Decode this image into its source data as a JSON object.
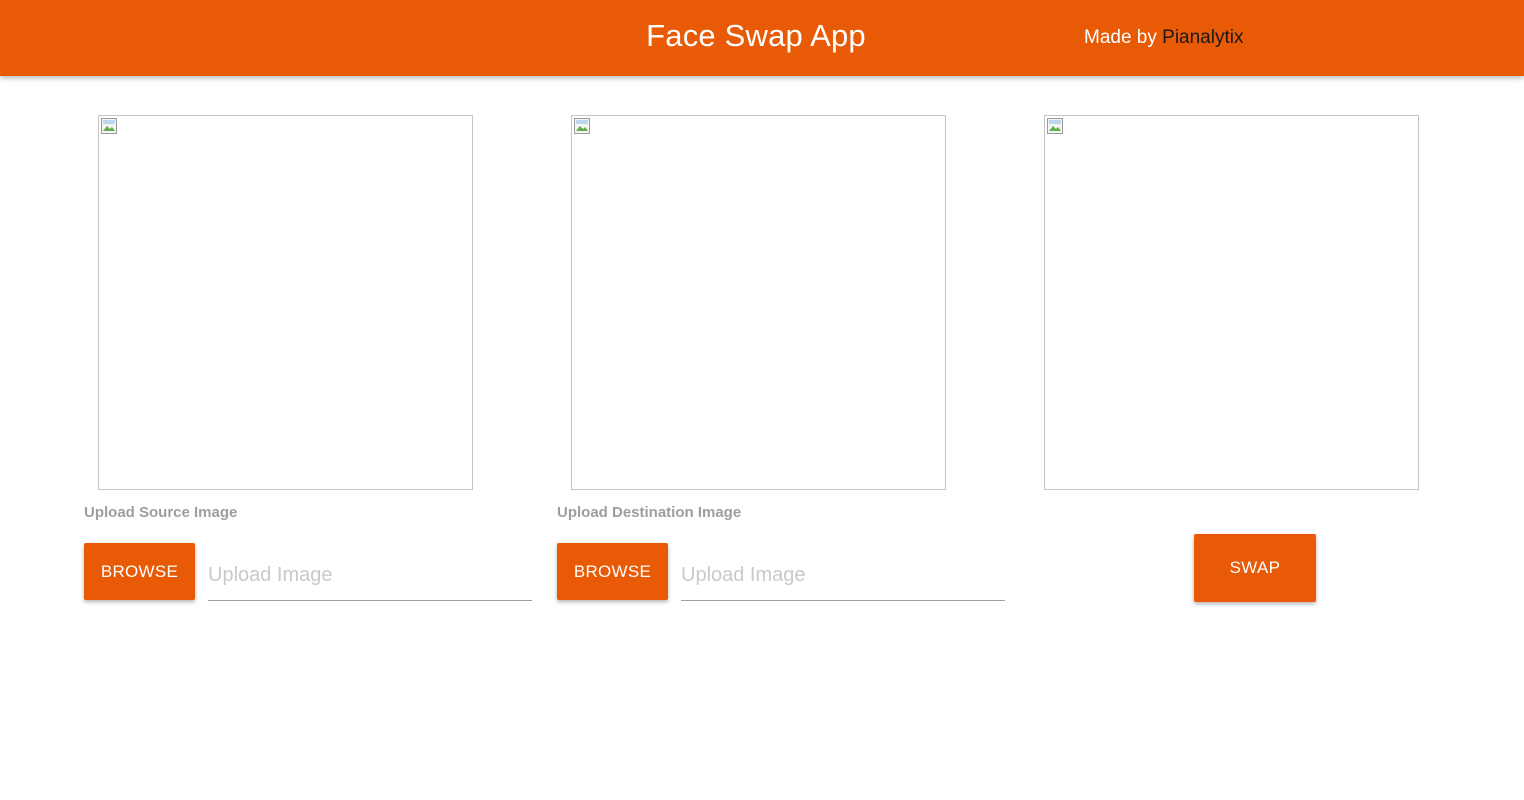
{
  "header": {
    "title": "Face Swap App",
    "credit_prefix": "Made by ",
    "credit_author": "Pianalytix"
  },
  "source": {
    "label": "Upload Source Image",
    "browse_label": "BROWSE",
    "input_value": "",
    "input_placeholder": "Upload Image"
  },
  "destination": {
    "label": "Upload Destination Image",
    "browse_label": "BROWSE",
    "input_value": "",
    "input_placeholder": "Upload Image"
  },
  "swap": {
    "button_label": "SWAP"
  },
  "colors": {
    "accent": "#e85a05",
    "label_gray": "#9e9e9e"
  },
  "icons": {
    "image_placeholder": "broken-image-icon"
  }
}
